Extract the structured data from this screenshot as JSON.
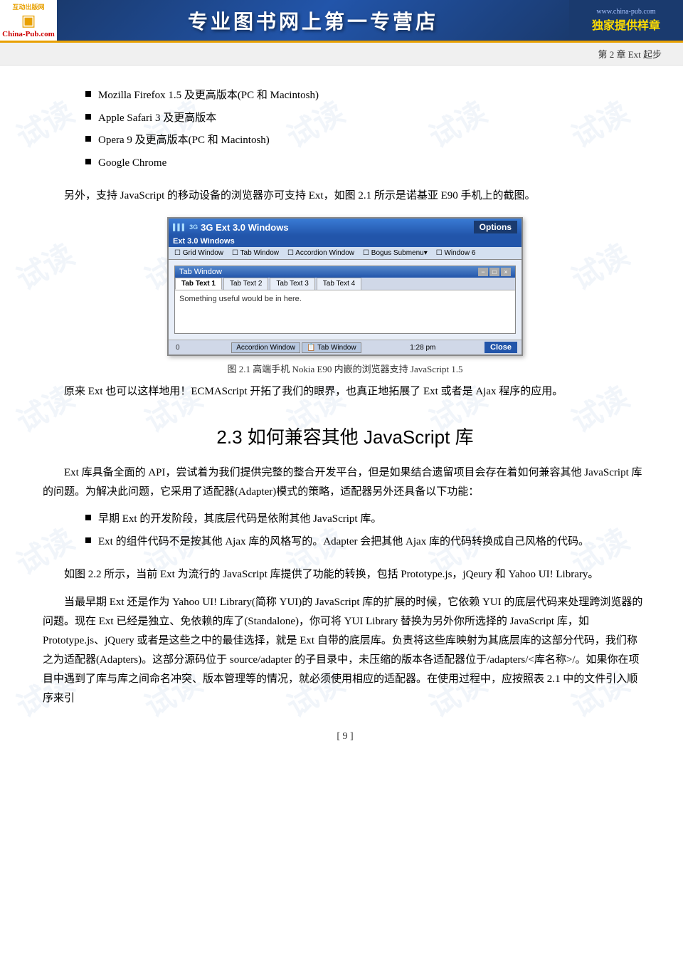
{
  "header": {
    "logo": {
      "top_text": "互动出版网",
      "main_text": "China-Pub.com",
      "icon_text": "▣"
    },
    "center_text": "专业图书网上第一专营店",
    "right_url": "www.china-pub.com",
    "right_slogan": "独家提供样章"
  },
  "chapter_bar": {
    "text": "第 2 章   Ext 起步"
  },
  "bullet_items": [
    "Mozilla Firefox 1.5 及更高版本(PC 和 Macintosh)",
    "Apple Safari 3 及更高版本",
    "Opera 9 及更高版本(PC 和 Macintosh)",
    "Google Chrome"
  ],
  "para1": "另外，支持 JavaScript 的移动设备的浏览器亦可支持 Ext，如图 2.1 所示是诺基亚 E90 手机上的截图。",
  "figure": {
    "mock_title": "3G Ext 3.0 Windows",
    "mock_subtitle": "Ext 3.0 Windows",
    "signal": "▌▌▌",
    "options_label": "Options",
    "menu_items": [
      "Grid Window",
      "Tab Window",
      "Accordion Window",
      "Bogus Submenu▾",
      "Window 6"
    ],
    "window_title": "Tab Window",
    "tabs": [
      "Tab Text 1",
      "Tab Text 2",
      "Tab Text 3",
      "Tab Text 4"
    ],
    "body_text": "Something useful would be in here.",
    "bottom_tabs": [
      "Accordion Window",
      "Tab Window"
    ],
    "time": "1:28 pm",
    "close_label": "Close",
    "status_num": "0",
    "caption": "图 2.1    高端手机 Nokia E90 内嵌的浏览器支持 JavaScript 1.5"
  },
  "para2": "原来 Ext 也可以这样地用！ECMAScript 开拓了我们的眼界，也真正地拓展了 Ext 或者是 Ajax 程序的应用。",
  "section_heading": "2.3    如何兼容其他 JavaScript 库",
  "para3": "Ext 库具备全面的 API，尝试着为我们提供完整的整合开发平台，但是如果结合遗留项目会存在着如何兼容其他 JavaScript 库的问题。为解决此问题，它采用了适配器(Adapter)模式的策略，适配器另外还具备以下功能：",
  "bullet2_items": [
    "早期 Ext 的开发阶段，其底层代码是依附其他 JavaScript 库。",
    "Ext 的组件代码不是按其他 Ajax 库的风格写的。Adapter 会把其他 Ajax 库的代码转换成自己风格的代码。"
  ],
  "para4": "如图 2.2 所示，当前 Ext 为流行的 JavaScript 库提供了功能的转换，包括 Prototype.js，jQeury 和 Yahoo UI! Library。",
  "para5": "当最早期 Ext 还是作为 Yahoo UI! Library(简称 YUI)的 JavaScript 库的扩展的时候，它依赖 YUI 的底层代码来处理跨浏览器的问题。现在 Ext 已经是独立、免依赖的库了(Standalone)，你可将 YUI Library 替换为另外你所选择的 JavaScript 库，如 Prototype.js、jQuery 或者是这些之中的最佳选择，就是 Ext 自带的底层库。负责将这些库映射为其底层库的这部分代码，我们称之为适配器(Adapters)。这部分源码位于 source/adapter 的子目录中，未压缩的版本各适配器位于/adapters/<库名称>/。如果你在项目中遇到了库与库之间命名冲突、版本管理等的情况，就必须使用相应的适配器。在使用过程中，应按照表 2.1 中的文件引入顺序来引",
  "page_number": "[ 9 ]",
  "watermark_text": "试读"
}
